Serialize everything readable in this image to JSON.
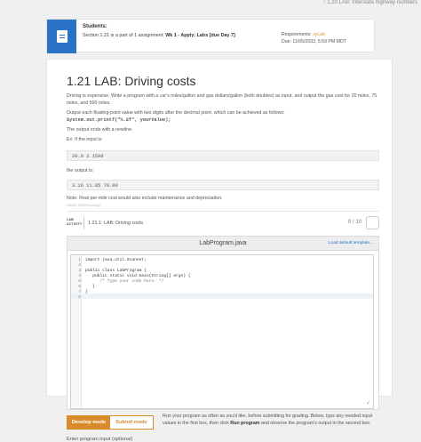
{
  "next_link": {
    "arrow": "↑",
    "label": "1.20 LAB: Interstate highway numbers"
  },
  "assignment": {
    "students": "Students:",
    "section_prefix": "Section 1.21 is a part of 1 assignment: ",
    "assignment_name": "Wk 1 - Apply: Labs [due Day 7]",
    "requirements_label": "Requirements: ",
    "requirements_value": "zyLab",
    "due": "Due: 11/05/2033, 5:59 PM MDT",
    "icon": "document-icon"
  },
  "lab": {
    "title": "1.21 LAB: Driving costs",
    "description": "Driving is expensive. Write a program with a car's miles/gallon and gas dollars/gallon (both doubles) as input, and output the gas cost for 20 miles, 75 miles, and 500 miles.",
    "format_text": "Output each floating-point value with two digits after the decimal point, which can be achieved as follows:",
    "format_code": "System.out.printf(\"%.2f\", yourValue);",
    "newline_text": "The output ends with a newline.",
    "ex_text": "Ex: If the input is:",
    "ex_input": "20.0 3.1599",
    "output_is_text": "the output is:",
    "ex_output": "3.16 11.85 79.00",
    "note": "Note: Real per-mile cost would also include maintenance and depreciation.",
    "hash": "466482.3388016.qx3zqy7"
  },
  "activity": {
    "badge_line1": "LAB",
    "badge_line2": "ACTIVITY",
    "name": "1.21.1: LAB: Driving costs",
    "score": "0 / 10"
  },
  "editor": {
    "filename": "LabProgram.java",
    "load_default": "Load default template...",
    "line_numbers": [
      "1",
      "2",
      "3",
      "4",
      "5",
      "6",
      "7",
      "8"
    ],
    "code_lines": [
      "import java.util.Scanner;",
      "",
      "public class LabProgram {",
      "   public static void main(String[] args) {",
      "      /* Type your code here. */",
      "   }",
      "}",
      ""
    ],
    "resize_glyph": "↙"
  },
  "modes": {
    "develop": "Develop mode",
    "submit": "Submit mode"
  },
  "run_info": {
    "part1": "Run your program as often as you'd like, before submitting for grading. Below, type any needed input values in the first box, then click ",
    "bold": "Run program",
    "part2": " and observe the program's output in the second box."
  },
  "enter_input": "Enter program input (optional)"
}
